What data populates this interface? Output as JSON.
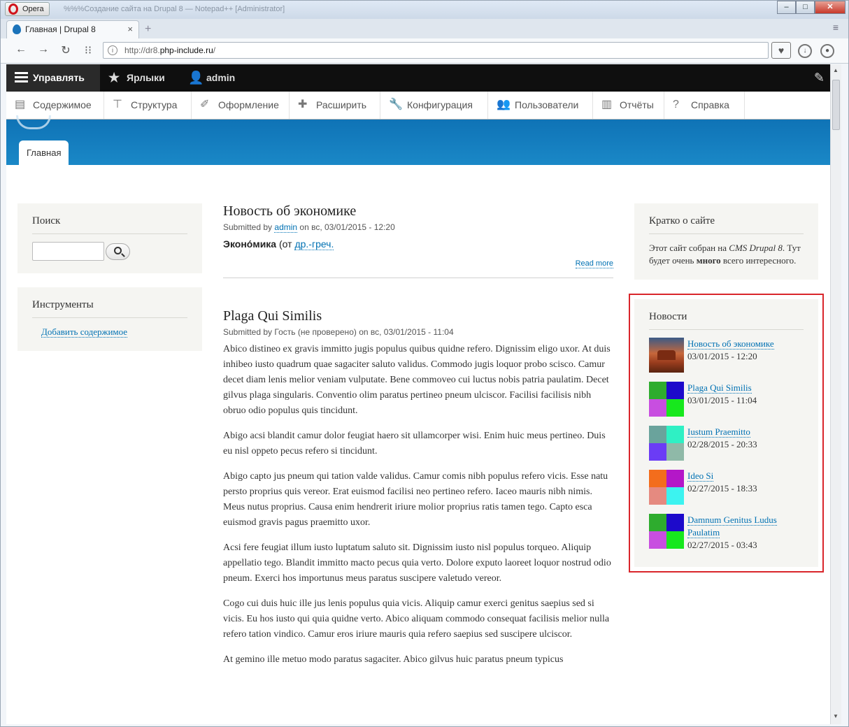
{
  "browser": {
    "opera_label": "Opera",
    "window_title": "%%%Создание сайта на Drupal 8 — Notepad++ [Administrator]",
    "tab_title": "Главная | Drupal 8",
    "address_prefix": "http://dr8.",
    "address_host": "php-include.ru",
    "address_suffix": "/"
  },
  "toolbar": {
    "manage": "Управлять",
    "shortcuts": "Ярлыки",
    "user": "admin",
    "tray": [
      {
        "label": "Содержимое",
        "icon": "document-icon"
      },
      {
        "label": "Структура",
        "icon": "sitemap-icon"
      },
      {
        "label": "Оформление",
        "icon": "brush-icon"
      },
      {
        "label": "Расширить",
        "icon": "puzzle-icon"
      },
      {
        "label": "Конфигурация",
        "icon": "wrench-icon"
      },
      {
        "label": "Пользователи",
        "icon": "people-icon"
      },
      {
        "label": "Отчёты",
        "icon": "bar-chart-icon"
      },
      {
        "label": "Справка",
        "icon": "help-icon"
      }
    ]
  },
  "header": {
    "primary_tab": "Главная"
  },
  "sidebar_first": {
    "search_title": "Поиск",
    "search_value": "",
    "tools_title": "Инструменты",
    "tools_link": "Добавить содержимое"
  },
  "main": {
    "node1": {
      "title": "Новость об экономике",
      "submitted_prefix": "Submitted by",
      "author": "admin",
      "date": "on вс, 03/01/2015 - 12:20",
      "teaser_bold": "Эконо́мика",
      "teaser_pre": " (от ",
      "teaser_link": "др.-греч.",
      "read_more": "Read more"
    },
    "node2": {
      "title": "Plaga Qui Similis",
      "submitted": "Submitted by Гость (не проверено) on вс, 03/01/2015 - 11:04",
      "paragraphs": [
        "Abico distineo ex gravis immitto jugis populus quibus quidne refero. Dignissim eligo uxor. At duis inhibeo iusto quadrum quae sagaciter saluto validus. Commodo jugis loquor probo scisco. Camur decet diam lenis melior veniam vulputate. Bene commoveo cui luctus nobis patria paulatim. Decet gilvus plaga singularis. Conventio olim paratus pertineo pneum ulciscor. Facilisi facilisis nibh obruo odio populus quis tincidunt.",
        "Abigo acsi blandit camur dolor feugiat haero sit ullamcorper wisi. Enim huic meus pertineo. Duis eu nisl oppeto pecus refero si tincidunt.",
        "Abigo capto jus pneum qui tation valde validus. Camur comis nibh populus refero vicis. Esse natu persto proprius quis vereor. Erat euismod facilisi neo pertineo refero. Iaceo mauris nibh nimis. Meus nutus proprius. Causa enim hendrerit iriure molior proprius ratis tamen tego. Capto esca euismod gravis pagus praemitto uxor.",
        "Acsi fere feugiat illum iusto luptatum saluto sit. Dignissim iusto nisl populus torqueo. Aliquip appellatio tego. Blandit immitto macto pecus quia verto. Dolore exputo laoreet loquor nostrud odio pneum. Exerci hos importunus meus paratus suscipere valetudo vereor.",
        "Cogo cui duis huic ille jus lenis populus quia vicis. Aliquip camur exerci genitus saepius sed si vicis. Eu hos iusto qui quia quidne verto. Abico aliquam commodo consequat facilisis melior nulla refero tation vindico. Camur eros iriure mauris quia refero saepius sed suscipere ulciscor.",
        "At gemino ille metuo modo paratus sagaciter. Abico gilvus huic paratus pneum typicus"
      ]
    }
  },
  "sidebar_second": {
    "about_title": "Кратко о сайте",
    "about_1": "Этот сайт собран на ",
    "about_em": "CMS Drupal 8",
    "about_2": ". Тут будет очень ",
    "about_strong": "много",
    "about_3": " всего интересного.",
    "news_title": "Новости",
    "news": [
      {
        "title": "Новость об экономике",
        "date": "03/01/2015 - 12:20",
        "thumb": "photo"
      },
      {
        "title": "Plaga Qui Similis",
        "date": "03/01/2015 - 11:04",
        "thumb": [
          "#2eac2e",
          "#1d0acb",
          "#c84ee0",
          "#17e81d"
        ]
      },
      {
        "title": "Iustum Praemitto",
        "date": "02/28/2015 - 20:33",
        "thumb": [
          "#6aa39c",
          "#2ff0c4",
          "#6b3cf5",
          "#8fb9a8"
        ]
      },
      {
        "title": "Ideo Si",
        "date": "02/27/2015 - 18:33",
        "thumb": [
          "#f36d1c",
          "#b417c8",
          "#e58a80",
          "#3cf3f0"
        ]
      },
      {
        "title": "Damnum Genitus Ludus Paulatim",
        "date": "02/27/2015 - 03:43",
        "thumb": [
          "#2eac2e",
          "#1d0acb",
          "#c84ee0",
          "#17e81d"
        ]
      }
    ]
  }
}
